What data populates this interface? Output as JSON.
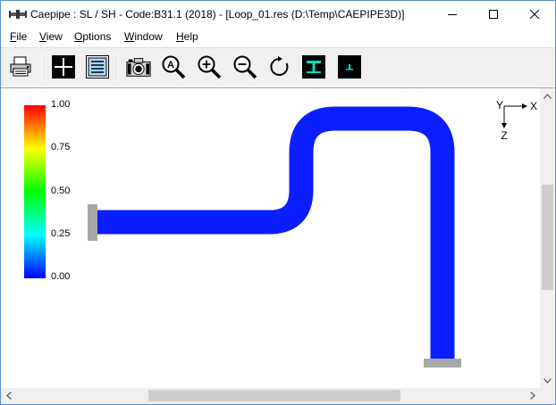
{
  "window": {
    "title": "Caepipe : SL / SH - Code:B31.1 (2018) -  [Loop_01.res (D:\\Temp\\CAEPIPE3D)]"
  },
  "menu": {
    "file": {
      "hot": "F",
      "rest": "ile"
    },
    "view": {
      "hot": "V",
      "rest": "iew"
    },
    "options": {
      "hot": "O",
      "rest": "ptions"
    },
    "window": {
      "hot": "W",
      "rest": "indow"
    },
    "help": {
      "hot": "H",
      "rest": "elp"
    }
  },
  "toolbar": {
    "icons": [
      "printer-icon",
      "crosshair-icon",
      "report-icon",
      "camera-icon",
      "zoom-all-icon",
      "zoom-in-icon",
      "zoom-out-icon",
      "rotate-icon",
      "section-t-icon",
      "section-small-icon"
    ]
  },
  "legend": {
    "labels": [
      "1.00",
      "0.75",
      "0.50",
      "0.25",
      "0.00"
    ]
  },
  "axes": {
    "x": "X",
    "y": "Y",
    "z": "Z"
  },
  "colors": {
    "pipe_blue": "#0000ff",
    "anchor_gray": "#a8a8a8",
    "toolbar_bg": "#f0f0f0"
  }
}
